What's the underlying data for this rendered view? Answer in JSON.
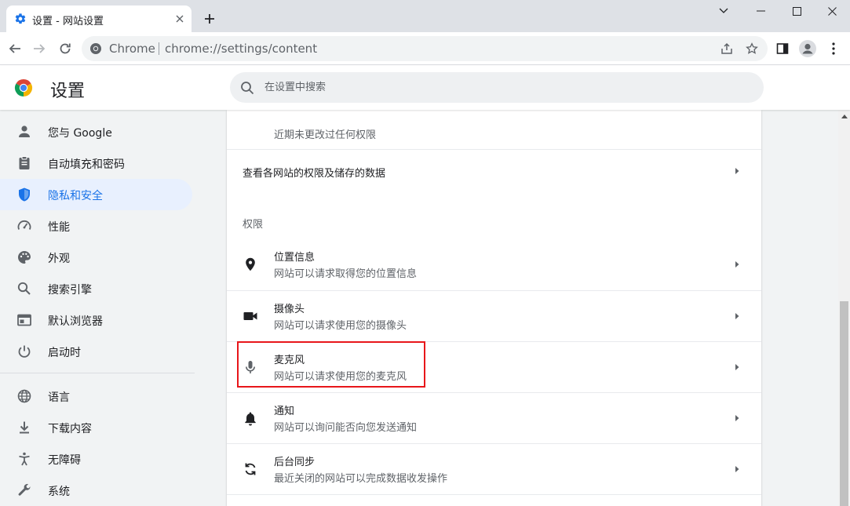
{
  "tab": {
    "title": "设置 - 网站设置",
    "close_icon": "close-icon",
    "favicon": "gear-icon"
  },
  "window": {
    "minimize": "minimize-icon",
    "maximize": "maximize-icon",
    "close": "close-icon",
    "tab_search": "chevron-down-icon"
  },
  "toolbar": {
    "back": "back-arrow-icon",
    "forward": "forward-arrow-icon",
    "reload": "reload-icon"
  },
  "omnibox": {
    "chip": "Chrome",
    "url": "chrome://settings/content"
  },
  "header": {
    "title": "设置",
    "search_placeholder": "在设置中搜索"
  },
  "sidebar": {
    "items": [
      {
        "label": "您与 Google",
        "icon": "person-icon"
      },
      {
        "label": "自动填充和密码",
        "icon": "clipboard-icon"
      },
      {
        "label": "隐私和安全",
        "icon": "shield-icon",
        "active": true
      },
      {
        "label": "性能",
        "icon": "speedometer-icon"
      },
      {
        "label": "外观",
        "icon": "palette-icon"
      },
      {
        "label": "搜索引擎",
        "icon": "search-icon"
      },
      {
        "label": "默认浏览器",
        "icon": "browser-icon"
      },
      {
        "label": "启动时",
        "icon": "power-icon"
      },
      {
        "label": "语言",
        "icon": "globe-icon"
      },
      {
        "label": "下载内容",
        "icon": "download-icon"
      },
      {
        "label": "无障碍",
        "icon": "accessibility-icon"
      },
      {
        "label": "系统",
        "icon": "wrench-icon"
      }
    ]
  },
  "main": {
    "recent_note": "近期未更改过任何权限",
    "view_all_label": "查看各网站的权限及储存的数据",
    "section_title": "权限",
    "permissions": [
      {
        "title": "位置信息",
        "desc": "网站可以请求取得您的位置信息",
        "icon": "location-pin-icon"
      },
      {
        "title": "摄像头",
        "desc": "网站可以请求使用您的摄像头",
        "icon": "camera-icon"
      },
      {
        "title": "麦克风",
        "desc": "网站可以请求使用您的麦克风",
        "icon": "microphone-icon",
        "highlighted": true
      },
      {
        "title": "通知",
        "desc": "网站可以询问能否向您发送通知",
        "icon": "bell-icon"
      },
      {
        "title": "后台同步",
        "desc": "最近关闭的网站可以完成数据收发操作",
        "icon": "sync-icon"
      }
    ]
  },
  "colors": {
    "accent": "#1a73e8",
    "active_bg": "#e8f0fe",
    "highlight_border": "#e8161a",
    "page_bg": "#f1f3f4"
  }
}
